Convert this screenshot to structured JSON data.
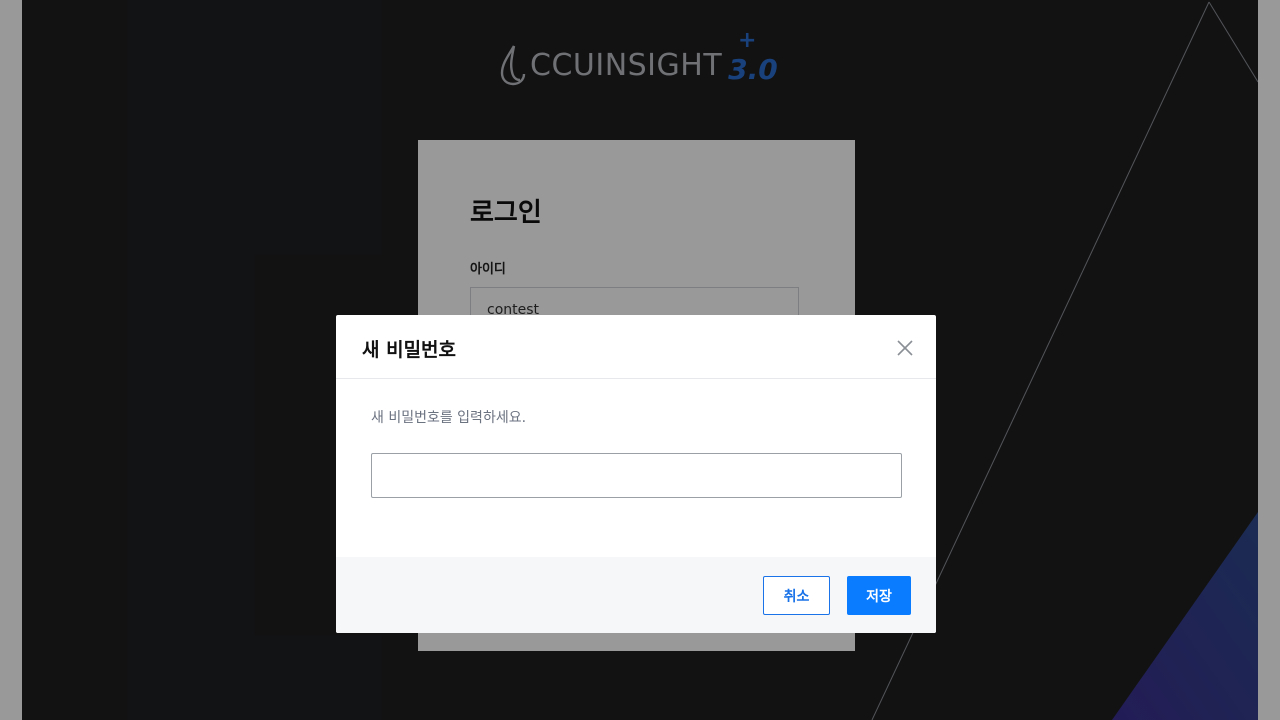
{
  "brand": {
    "name": "CCUINSIGHT",
    "plus": "+",
    "version": "3.0",
    "accent_color": "#2b6fd0"
  },
  "login": {
    "title": "로그인",
    "id_label": "아이디",
    "id_value": "contest"
  },
  "dialog": {
    "title": "새 비밀번호",
    "close_icon": "close-icon",
    "description": "새 비밀번호를 입력하세요.",
    "password_value": "",
    "cancel_label": "취소",
    "save_label": "저장",
    "primary_color": "#0a7cff"
  }
}
